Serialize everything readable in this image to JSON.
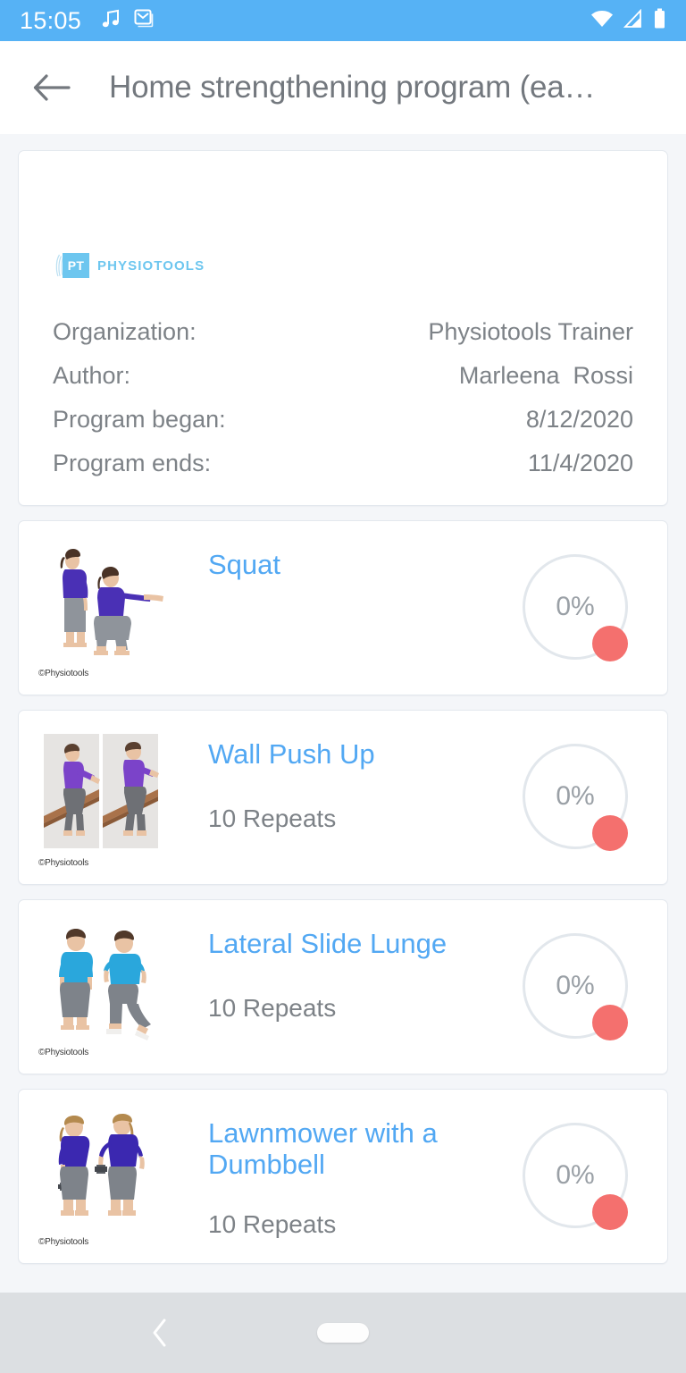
{
  "status_bar": {
    "time": "15:05",
    "left_icons": [
      "music-note-icon",
      "gmail-icon"
    ],
    "right_icons": [
      "wifi-icon",
      "cellular-signal-icon",
      "battery-icon"
    ],
    "background_color": "#56b2f5"
  },
  "app_bar": {
    "back_icon": "back-arrow-icon",
    "title": "Home strengthening program (ea…"
  },
  "info_card": {
    "logo": {
      "mark_text": "PT",
      "wordmark": "PHYSIOTOOLS",
      "color": "#6dc6ef"
    },
    "rows": [
      {
        "label": "Organization:",
        "value": "Physiotools Trainer"
      },
      {
        "label": "Author:",
        "value": "Marleena  Rossi"
      },
      {
        "label": "Program began:",
        "value": "8/12/2020"
      },
      {
        "label": "Program ends:",
        "value": "11/4/2020"
      }
    ]
  },
  "exercises": [
    {
      "title": "Squat",
      "repeats": "",
      "progress": "0%",
      "thumb": "squat-thumbnail",
      "watermark": "©Physiotools"
    },
    {
      "title": "Wall Push Up",
      "repeats": "10 Repeats",
      "progress": "0%",
      "thumb": "wall-push-up-thumbnail",
      "watermark": "©Physiotools"
    },
    {
      "title": "Lateral Slide Lunge",
      "repeats": "10 Repeats",
      "progress": "0%",
      "thumb": "lateral-slide-lunge-thumbnail",
      "watermark": "©Physiotools"
    },
    {
      "title": "Lawnmower with a Dumbbell",
      "repeats": "10 Repeats",
      "progress": "0%",
      "thumb": "lawnmower-dumbbell-thumbnail",
      "watermark": "©Physiotools"
    }
  ],
  "nav_bar": {
    "back_icon": "nav-back-chevron-icon",
    "home_indicator": "home-pill-indicator"
  },
  "colors": {
    "accent_blue": "#52a8f3",
    "status_blue": "#56b2f5",
    "badge_red": "#f4706e",
    "text_gray": "#7d8287",
    "page_bg": "#f4f6f9",
    "ring_gray": "#e2e7ec"
  }
}
